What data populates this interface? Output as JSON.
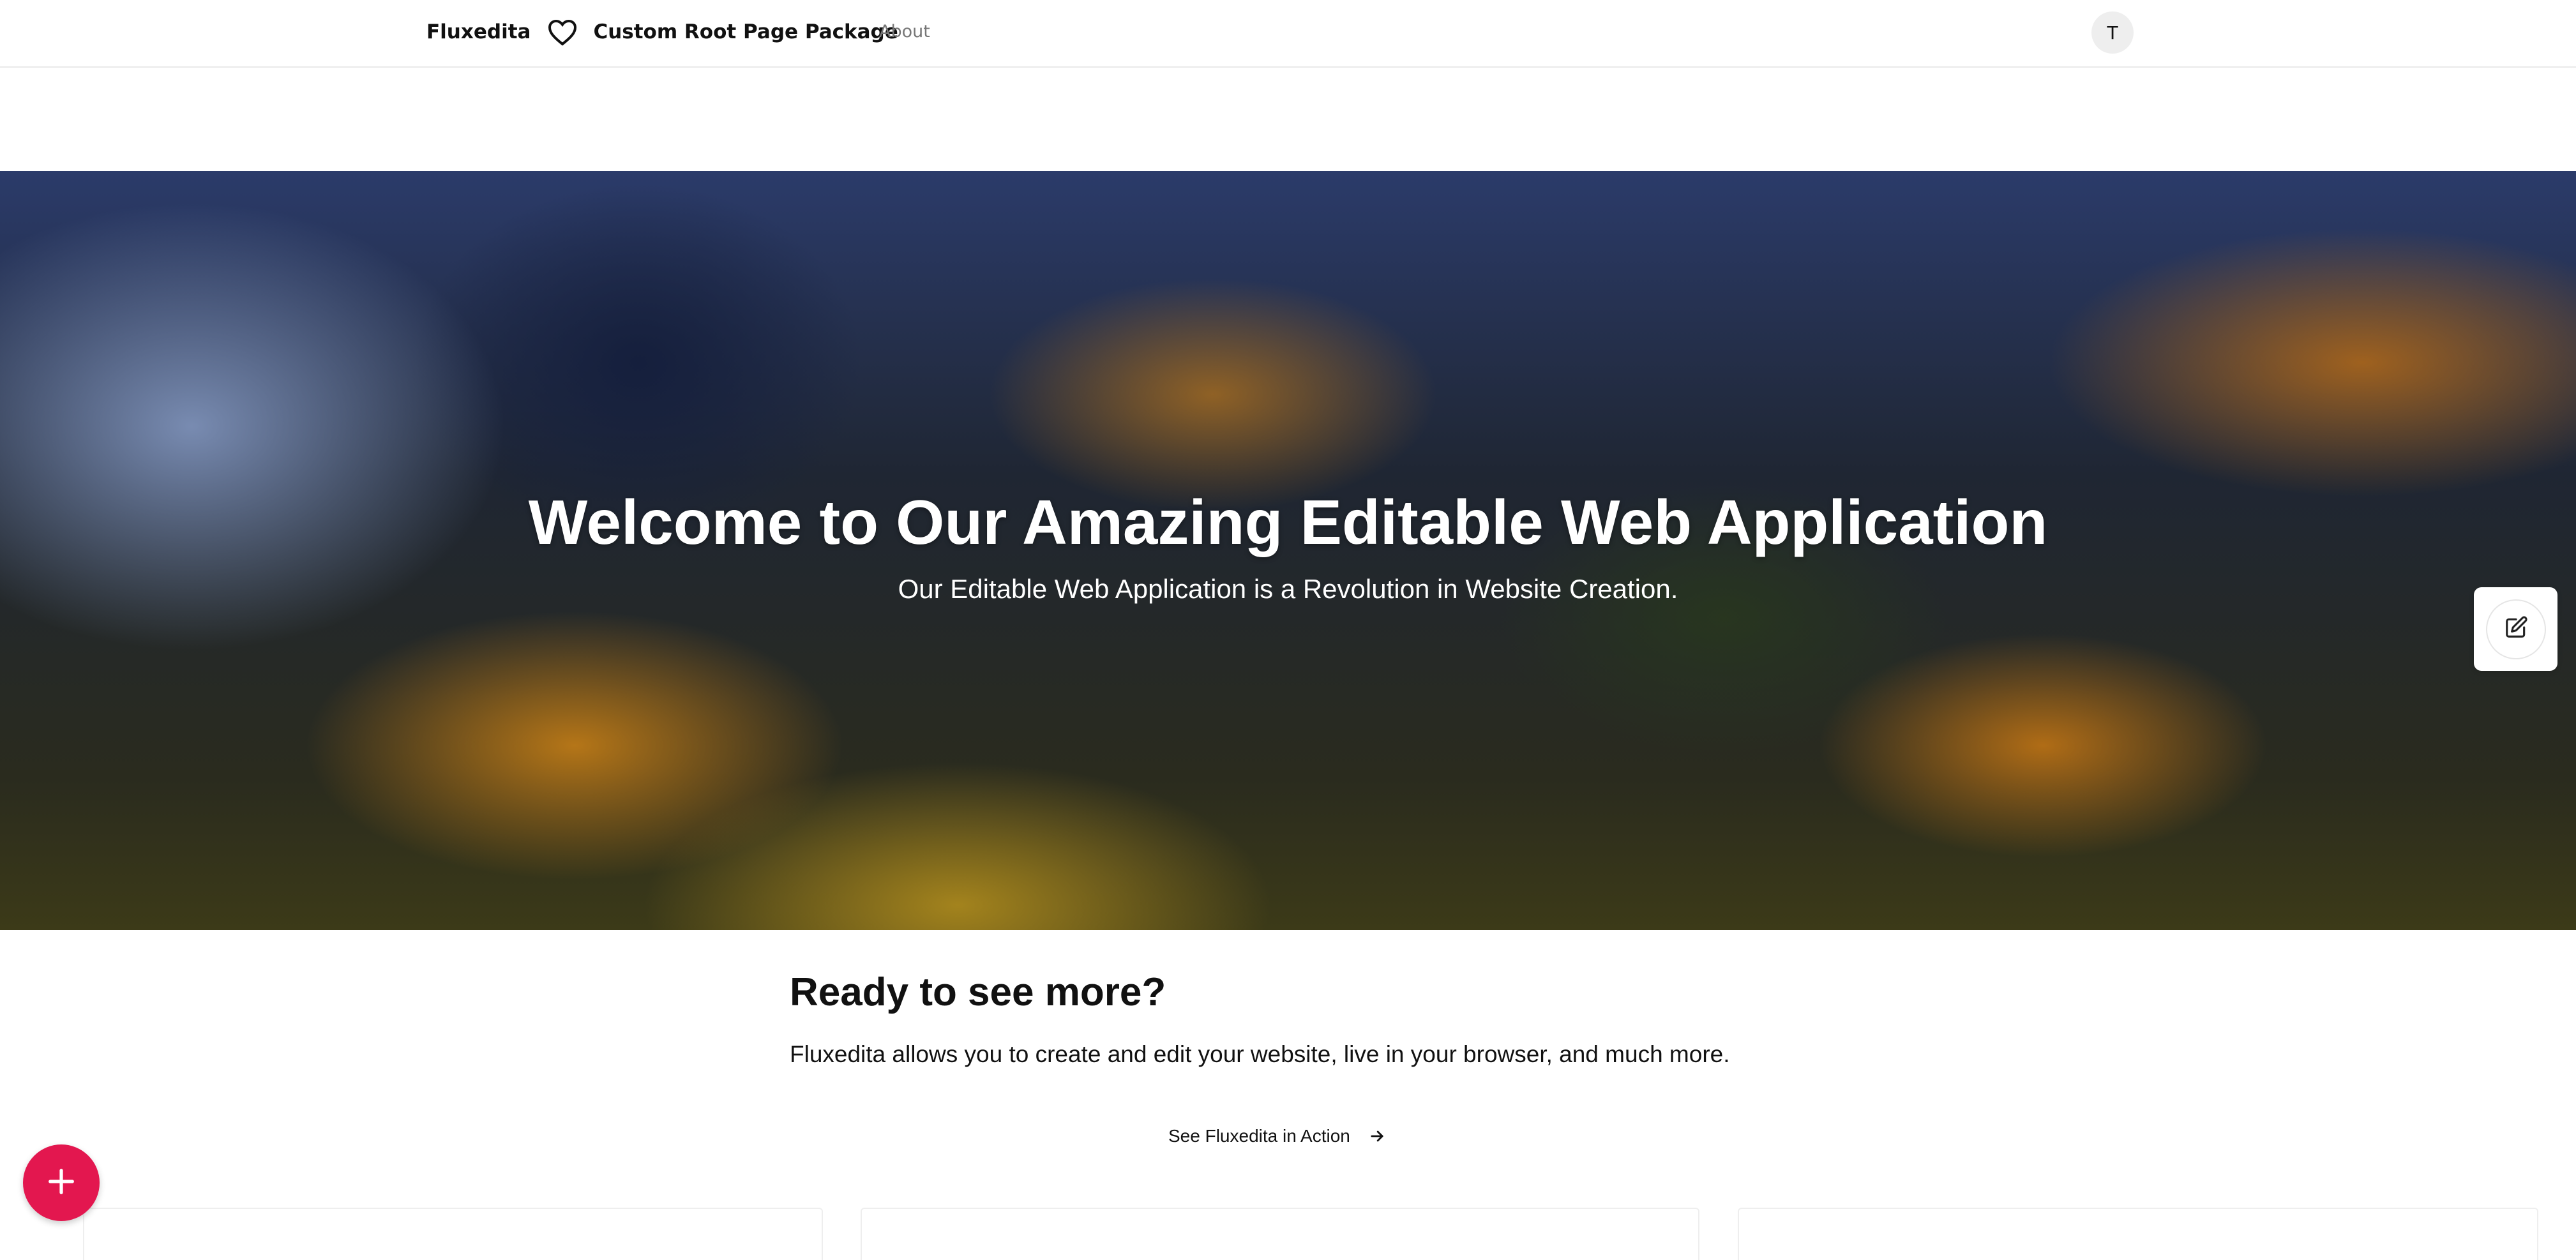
{
  "header": {
    "brand": "Fluxedita",
    "package_name": "Custom Root Page Package",
    "nav_about": "About",
    "avatar_initial": "T"
  },
  "hero": {
    "title": "Welcome to Our Amazing Editable Web Application",
    "subtitle": "Our Editable Web Application is a Revolution in Website Creation."
  },
  "section": {
    "title": "Ready to see more?",
    "text": "Fluxedita allows you to create and edit your website, live in your browser, and much more.",
    "cta_label": "See Fluxedita in Action"
  },
  "colors": {
    "fab": "#e3174f",
    "text": "#111111",
    "nav_muted": "#777777"
  },
  "icons": {
    "logo": "heart-icon",
    "edit": "edit-icon",
    "cta": "arrow-right-icon",
    "fab": "plus-icon"
  }
}
